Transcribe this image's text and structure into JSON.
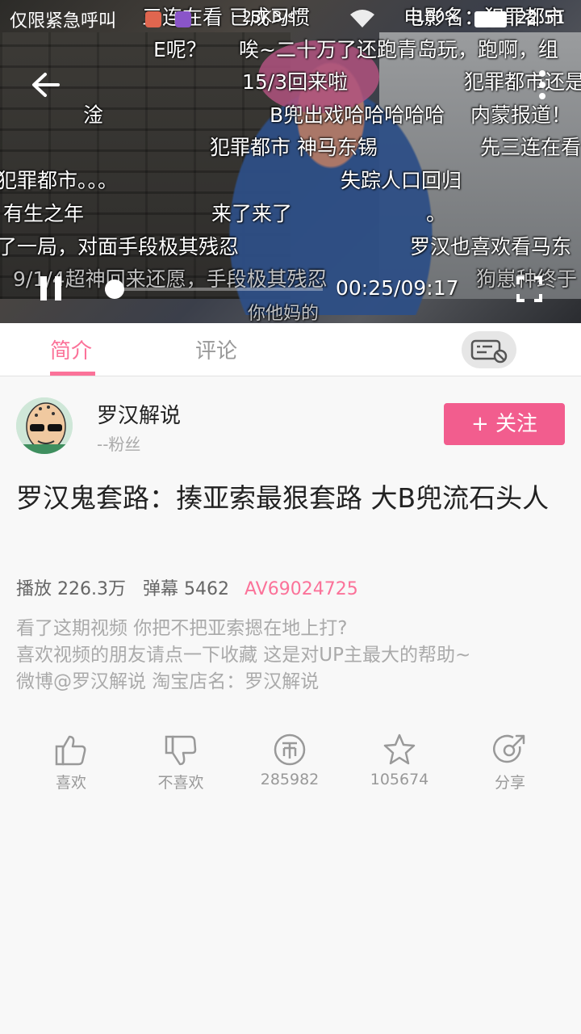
{
  "status_bar": {
    "carrier": "仅限紧急呼叫",
    "speed": "23KB/s",
    "battery": "100%",
    "time": "22:51"
  },
  "danmaku": [
    {
      "text": "三连在看 已成习惯"
    },
    {
      "text": "电影名：犯罪都市"
    },
    {
      "text": "E呢？"
    },
    {
      "text": "唉~二十万了还跑青岛玩，跑啊，组"
    },
    {
      "text": "15/3回来啦"
    },
    {
      "text": "犯罪都市还是"
    },
    {
      "text": "淦"
    },
    {
      "text": "B兜出戏哈哈哈哈哈"
    },
    {
      "text": "内蒙报道！"
    },
    {
      "text": "犯罪都市 神马东锡"
    },
    {
      "text": "先三连在看"
    },
    {
      "text": "犯罪都市。。。"
    },
    {
      "text": "失踪人口回归"
    },
    {
      "text": "有生之年"
    },
    {
      "text": "来了来了"
    },
    {
      "text": "。"
    },
    {
      "text": "了一局，对面手段极其残忍"
    },
    {
      "text": "罗汉也喜欢看马东"
    },
    {
      "text": "9/1/4超神回来还愿，手段极其残忍"
    },
    {
      "text": "狗崽种终于"
    },
    {
      "text": "你他妈的"
    }
  ],
  "player": {
    "time_label": "00:25/09:17",
    "progress_fraction": 0.045,
    "accent_color": "#fb7299"
  },
  "tabs": [
    {
      "label": "简介"
    },
    {
      "label": "评论"
    }
  ],
  "uploader": {
    "name": "罗汉解说",
    "fans": "--粉丝",
    "follow_label": "+ 关注"
  },
  "video": {
    "title": "罗汉鬼套路：揍亚索最狠套路 大B兜流石头人",
    "views_label": "播放",
    "views": "226.3万",
    "danmaku_label": "弹幕",
    "danmaku_count": "5462",
    "av": "AV69024725",
    "description": [
      "看了这期视频 你把不把亚索摁在地上打?",
      "喜欢视频的朋友请点一下收藏 这是对UP主最大的帮助~",
      "微博@罗汉解说  淘宝店名：罗汉解说"
    ]
  },
  "actions": [
    {
      "icon": "thumb-up-icon",
      "label": "喜欢"
    },
    {
      "icon": "thumb-down-icon",
      "label": "不喜欢"
    },
    {
      "icon": "coin-icon",
      "label": "285982"
    },
    {
      "icon": "star-icon",
      "label": "105674"
    },
    {
      "icon": "share-icon",
      "label": "分享"
    }
  ]
}
